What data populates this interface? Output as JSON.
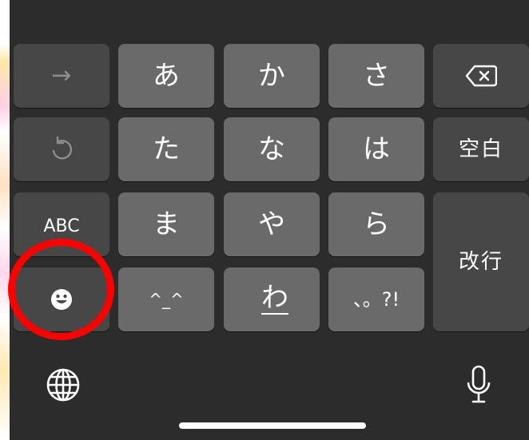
{
  "keyboard": {
    "row1": {
      "arrow": "→",
      "k1": "あ",
      "k2": "か",
      "k3": "さ"
    },
    "row2": {
      "k1": "た",
      "k2": "な",
      "k3": "は",
      "space": "空白"
    },
    "row3": {
      "abc": "ABC",
      "k1": "ま",
      "k2": "や",
      "k3": "ら",
      "enter": "改行"
    },
    "row4": {
      "kaomoji": "^_^",
      "k2": "わ",
      "punct": "、。?!"
    }
  },
  "icons": {
    "undo": "undo-icon",
    "delete": "delete-icon",
    "emoji": "emoji-icon",
    "globe": "globe-icon",
    "mic": "microphone-icon"
  },
  "colors": {
    "keyboard_bg": "#2c2c2c",
    "main_key": "#6a6a6a",
    "func_key": "#474747",
    "highlight_ring": "#ff0000"
  }
}
